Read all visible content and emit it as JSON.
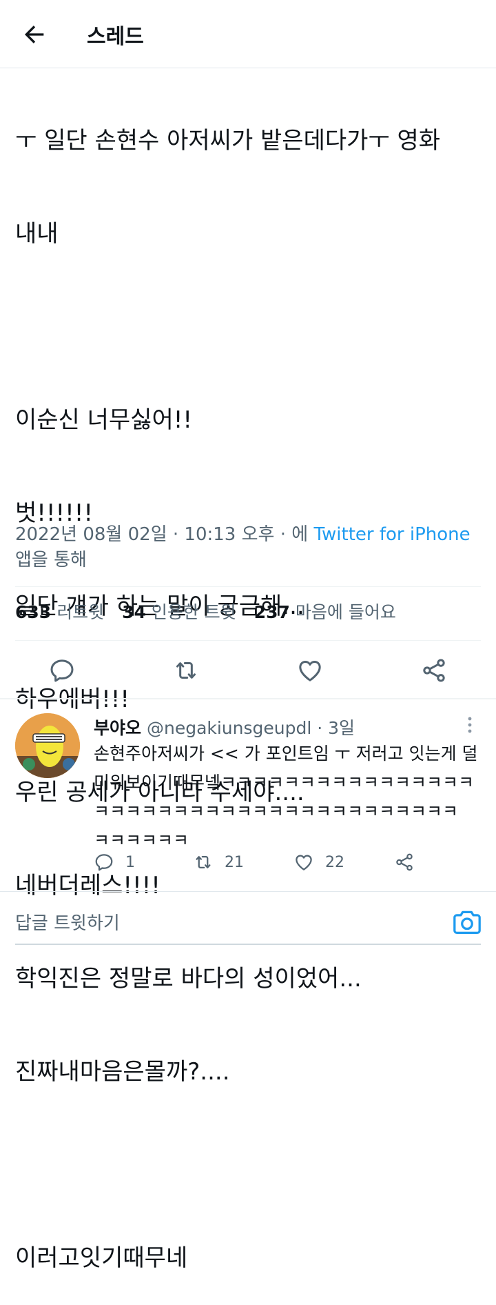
{
  "header": {
    "title": "스레드"
  },
  "tweet": {
    "lines": [
      "ㅜ 일단 손현수 아저씨가 밭은데다가ㅜ 영화",
      "내내",
      "",
      "이순신 너무싫어!!",
      "벗!!!!!!",
      "일단 걔가 하는 말이 궁금해...",
      "하우에버!!!",
      "우린 공세가 아니라 수세야....",
      "네버더레스!!!!",
      "학익진은 정말로 바다의 성이었어...",
      "진짜내마음은몰까?....",
      "",
      "이러고잇기때무네"
    ],
    "date": "2022년 08월 02일 · 10:13 오후 · 에",
    "source": "Twitter for iPhone",
    "source_suffix": "앱을 통해"
  },
  "stats": {
    "retweets_count": "633",
    "retweets_label": "리트윗",
    "quotes_count": "34",
    "quotes_label": "인용한 트윗",
    "likes_count": "237",
    "likes_label": "마음에 들어요"
  },
  "reply": {
    "name": "부야오",
    "handle": "@negakiunsgeupdl · 3일",
    "lines": [
      "손현주아저씨가 << 가 포인트임 ㅜ 저러고 잇는게 덜",
      "미워보이기때무넼ㅋㅋㅋㅋㅋㅋㅋㅋㅋㅋㅋㅋㅋㅋㅋㅋ",
      "ㅋㅋㅋㅋㅋㅋㅋㅋㅋㅋㅋㅋㅋㅋㅋㅋㅋㅋㅋㅋㅋㅋㅋ",
      "ㅋㅋㅋㅋㅋㅋ"
    ],
    "reply_count": "1",
    "retweet_count": "21",
    "like_count": "22"
  },
  "compose": {
    "placeholder": "답글 트윗하기"
  },
  "colors": {
    "accent": "#1d9bf0",
    "text": "#0f1419",
    "muted": "#536471"
  }
}
